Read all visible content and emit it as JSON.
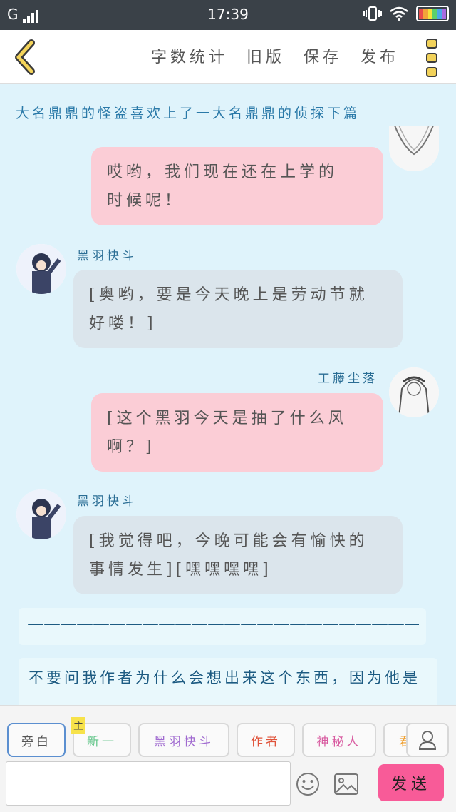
{
  "status_bar": {
    "carrier": "G",
    "time": "17:39",
    "battery_colors": [
      "#e84b4b",
      "#f2a33a",
      "#f5e23a",
      "#5bd06a",
      "#4aa8e8",
      "#a86ae0"
    ]
  },
  "toolbar": {
    "back_icon": "chevron-left-icon",
    "word_count": "字数统计",
    "old_version": "旧版",
    "save": "保存",
    "publish": "发布",
    "menu_icon": "kebab-menu-icon"
  },
  "story_title": "大名鼎鼎的怪盗喜欢上了一大名鼎鼎的侦探下篇",
  "messages": [
    {
      "side": "right",
      "speaker": "",
      "text_line1": "哎哟，我们现在还在上学的",
      "text_line2": "时候呢！"
    },
    {
      "side": "left",
      "speaker": "黑羽快斗",
      "text_line1": "[奥哟，要是今天晚上是劳动节就",
      "text_line2": "好喽！]"
    },
    {
      "side": "right",
      "speaker": "工藤尘落",
      "text_line1": "[这个黑羽今天是抽了什么风",
      "text_line2": "啊？]"
    },
    {
      "side": "left",
      "speaker": "黑羽快斗",
      "text_line1": "[我觉得吧，今晚可能会有愉快的",
      "text_line2": "事情发生][嘿嘿嘿嘿]"
    }
  ],
  "divider": "—————————————————————————",
  "note": "不要问我作者为什么会想出来这个东西，因为他是",
  "roles": {
    "narration": "旁白",
    "main_badge": "主",
    "shinichi": "新一",
    "kaito": "黑羽快斗",
    "author": "作者",
    "mystery": "神秘人",
    "partial": "君"
  },
  "composer": {
    "placeholder": "",
    "emoji_icon": "emoji-icon",
    "image_icon": "image-icon",
    "person_icon": "person-icon",
    "send": "发送"
  }
}
